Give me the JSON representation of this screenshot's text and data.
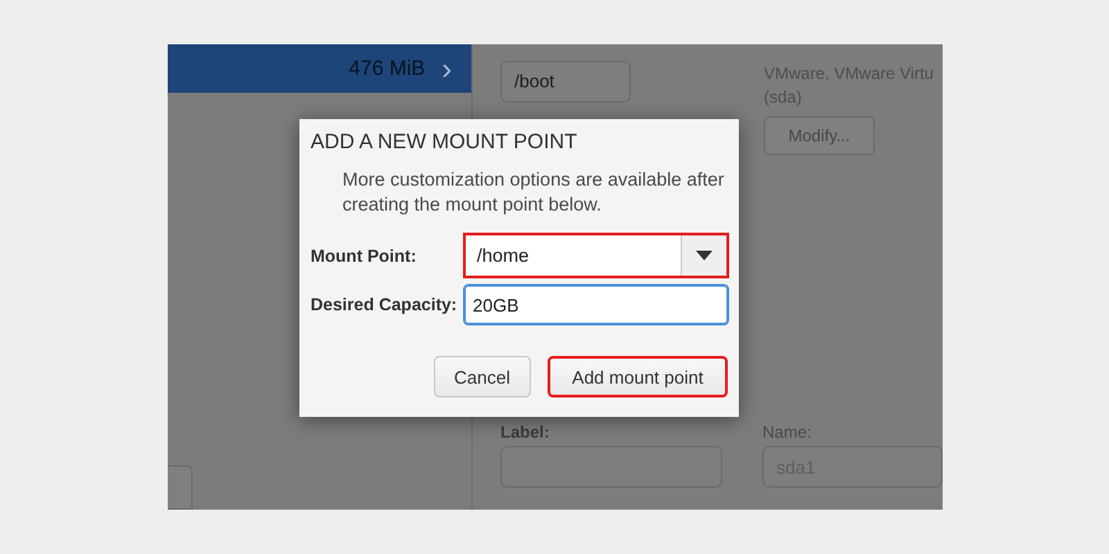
{
  "sidebar": {
    "selected_row": {
      "size": "476 MiB",
      "chevron": "›",
      "selected": true
    }
  },
  "details": {
    "mount_point_value": "/boot",
    "devices_text": "VMware, VMware Virtu",
    "devices_sub": "(sda)",
    "modify_button": "Modify...",
    "label_label": "Label:",
    "name_label": "Name:",
    "name_placeholder": "sda1"
  },
  "dialog": {
    "title": "ADD A NEW MOUNT POINT",
    "description": "More customization options are available after creating the mount point below.",
    "fields": [
      {
        "kind": "combo",
        "label": "Mount Point:",
        "value": "/home",
        "highlighted": true,
        "focused": false
      },
      {
        "kind": "entry",
        "label": "Desired Capacity:",
        "value": "20GB",
        "highlighted": false,
        "focused": true
      }
    ],
    "buttons": [
      {
        "label": "Cancel",
        "highlighted": false
      },
      {
        "label": "Add mount point",
        "highlighted": true
      }
    ]
  }
}
